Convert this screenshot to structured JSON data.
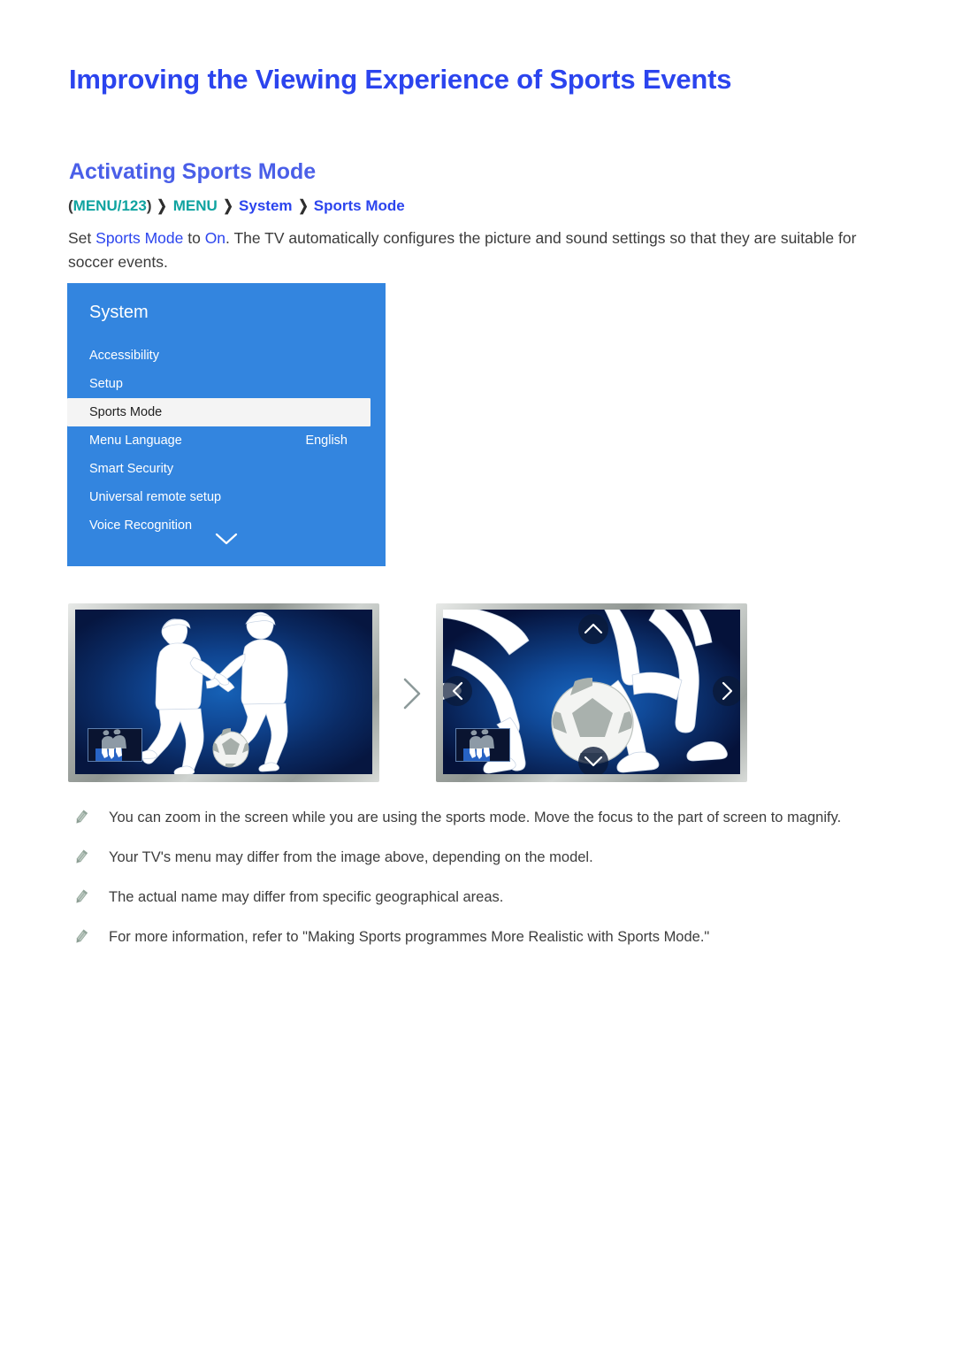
{
  "page": {
    "title": "Improving the Viewing Experience of Sports Events",
    "section_heading": "Activating Sports Mode"
  },
  "breadcrumb": {
    "open_paren": "(",
    "menu123": "MENU/123",
    "close_paren": ")",
    "menu": "MENU",
    "system": "System",
    "sports_mode": "Sports Mode",
    "separator": "❯"
  },
  "intro": {
    "before": "Set ",
    "link1": "Sports Mode",
    "middle": " to ",
    "link2": "On",
    "after": ". The TV automatically configures the picture and sound settings so that they are suitable for soccer events."
  },
  "tv_menu": {
    "title": "System",
    "items": [
      {
        "label": "Accessibility",
        "value": "",
        "selected": false
      },
      {
        "label": "Setup",
        "value": "",
        "selected": false
      },
      {
        "label": "Sports Mode",
        "value": "",
        "selected": true
      },
      {
        "label": "Menu Language",
        "value": "English",
        "selected": false
      },
      {
        "label": "Smart Security",
        "value": "",
        "selected": false
      },
      {
        "label": "Universal remote setup",
        "value": "",
        "selected": false
      },
      {
        "label": "Voice Recognition",
        "value": "",
        "selected": false
      }
    ],
    "scroll_icon": "chevron-down-icon"
  },
  "figures": {
    "left": {
      "name": "sports-mode-normal-view",
      "minimap": "screen-minimap"
    },
    "right": {
      "name": "sports-mode-zoomed-view",
      "minimap": "screen-minimap"
    },
    "step_arrow": "chevron-right-icon",
    "zoom_arrows": [
      "up-arrow-icon",
      "down-arrow-icon",
      "left-arrow-icon",
      "right-arrow-icon"
    ]
  },
  "notes": [
    {
      "icon": "pencil-note-icon",
      "text": "You can zoom in the screen while you are using the sports mode. Move the focus to the part of screen to magnify."
    },
    {
      "icon": "pencil-note-icon",
      "text": "Your TV's menu may differ from the image above, depending on the model."
    },
    {
      "icon": "pencil-note-icon",
      "text": "The actual name may differ from specific geographical areas."
    },
    {
      "icon": "pencil-note-icon",
      "text": "For more information, refer to \"Making Sports programmes More Realistic with Sports Mode.\""
    }
  ],
  "colors": {
    "title_blue": "#2b44ee",
    "heading_blue": "#4a5fe8",
    "breadcrumb_teal": "#0fa3a0",
    "menu_blue": "#3385df",
    "selected_row": "#f4f4f4",
    "note_icon": "#93a69b"
  }
}
